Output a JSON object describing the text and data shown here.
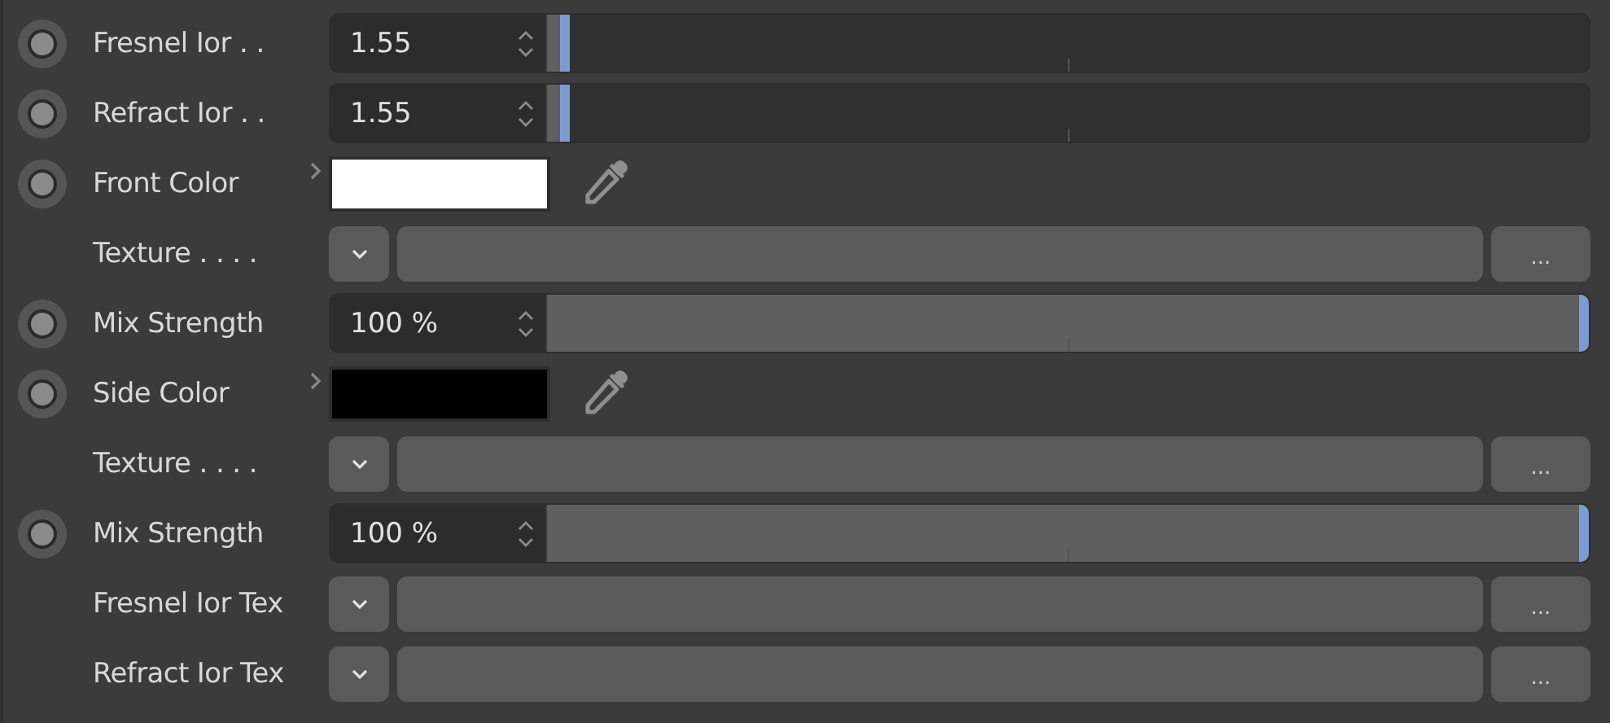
{
  "rows": [
    {
      "kind": "number",
      "label": "Fresnel Ior . .",
      "value": "1.55",
      "level": 0.01
    },
    {
      "kind": "number",
      "label": "Refract Ior . .",
      "value": "1.55",
      "level": 0.01
    },
    {
      "kind": "color",
      "label": "Front Color",
      "color": "#ffffff"
    },
    {
      "kind": "texture",
      "label": "Texture . . . .",
      "button": "..."
    },
    {
      "kind": "number",
      "label": "Mix Strength",
      "value": "100 %",
      "level": 1
    },
    {
      "kind": "color",
      "label": "Side Color",
      "color": "#000000"
    },
    {
      "kind": "texture",
      "label": "Texture . . . .",
      "button": "..."
    },
    {
      "kind": "number",
      "label": "Mix Strength",
      "value": "100 %",
      "level": 1
    },
    {
      "kind": "texture",
      "label": "Fresnel Ior Tex",
      "button": "..."
    },
    {
      "kind": "texture",
      "label": "Refract Ior Tex",
      "button": "..."
    }
  ]
}
